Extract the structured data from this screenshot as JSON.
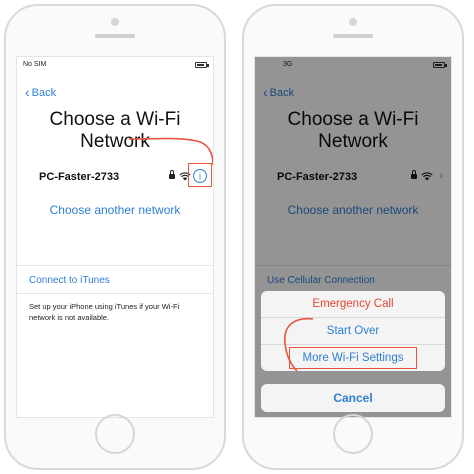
{
  "left_screen": {
    "status": {
      "carrier": "No SIM"
    },
    "back_label": "Back",
    "title_line1": "Choose a Wi-Fi",
    "title_line2": "Network",
    "network_name": "PC-Faster-2733",
    "info_symbol": "i",
    "choose_another": "Choose another network",
    "connect_itunes": "Connect to iTunes",
    "note": "Set up your iPhone using iTunes if your Wi-Fi network is not available."
  },
  "right_screen": {
    "status": {
      "carrier": "3G"
    },
    "back_label": "Back",
    "title_line1": "Choose a Wi-Fi",
    "title_line2": "Network",
    "network_name": "PC-Faster-2733",
    "choose_another": "Choose another network",
    "use_cellular": "Use Cellular Connection",
    "sheet": {
      "emergency_call": "Emergency Call",
      "start_over": "Start Over",
      "more_wifi_settings": "More Wi-Fi Settings"
    },
    "cancel_label": "Cancel"
  },
  "colors": {
    "accent_blue": "#2d7fd6",
    "highlight_red": "#e8563f",
    "emergency_red": "#e84433"
  },
  "icons": [
    "back-chevron-icon",
    "lock-icon",
    "wifi-icon",
    "info-icon",
    "chevron-right-icon",
    "battery-icon",
    "home-button"
  ]
}
